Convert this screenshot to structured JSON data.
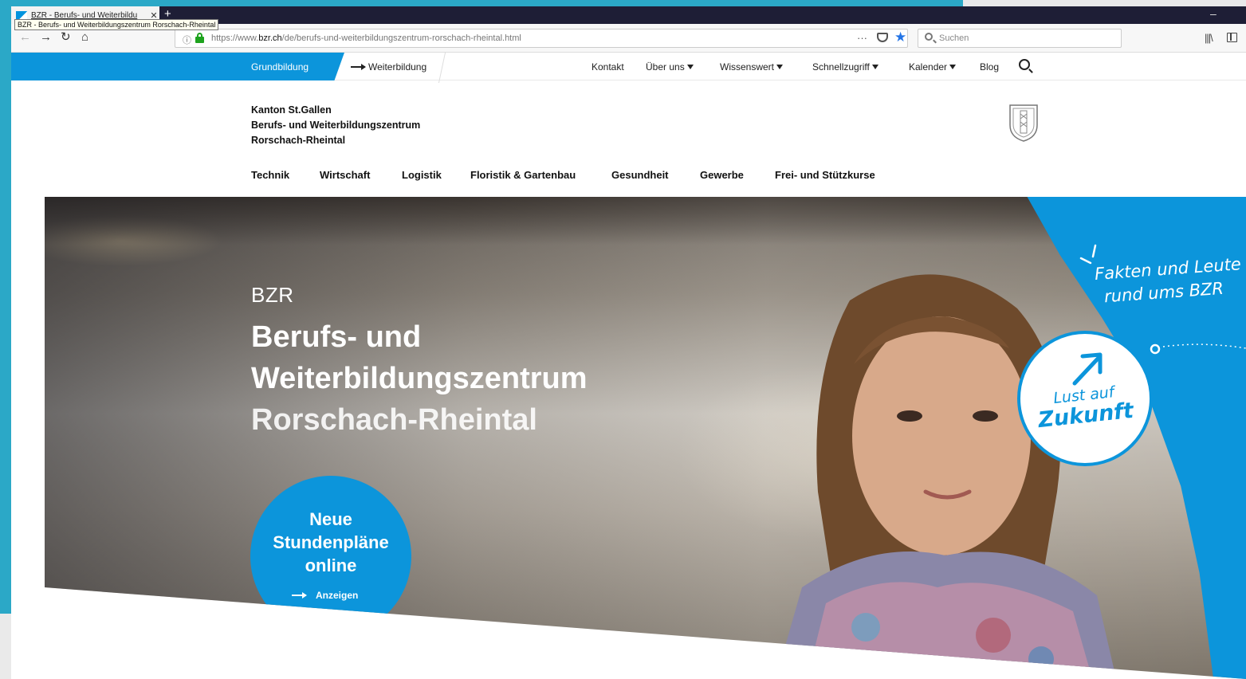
{
  "browser": {
    "tab_title": "BZR - Berufs- und Weiterbildu",
    "tab_close": "✕",
    "new_tab": "+",
    "tooltip": "BZR - Berufs- und Weiterbildungszentrum Rorschach-Rheintal",
    "url_prefix": "https://www.",
    "url_domain": "bzr.ch",
    "url_path": "/de/berufs-und-weiterbildungszentrum-rorschach-rheintal.html",
    "url_menu": "···",
    "search_placeholder": "Suchen",
    "minimize": "–",
    "icons": [
      "back-icon",
      "forward-icon",
      "reload-icon",
      "home-icon",
      "info-icon",
      "lock-icon",
      "pocket-icon",
      "star-icon",
      "library-icon",
      "sidebar-icon"
    ]
  },
  "site": {
    "topnav": {
      "tab_active": "Grundbildung",
      "tab_other": "Weiterbildung",
      "meta": [
        {
          "label": "Kontakt",
          "dropdown": false
        },
        {
          "label": "Über uns",
          "dropdown": true
        },
        {
          "label": "Wissenswert",
          "dropdown": true
        },
        {
          "label": "Schnellzugriff",
          "dropdown": true
        },
        {
          "label": "Kalender",
          "dropdown": true
        },
        {
          "label": "Blog",
          "dropdown": false
        }
      ]
    },
    "brand": {
      "line1": "Kanton St.Gallen",
      "line2": "Berufs- und Weiterbildungszentrum",
      "line3": "Rorschach-Rheintal"
    },
    "mainnav": [
      "Technik",
      "Wirtschaft",
      "Logistik",
      "Floristik & Gartenbau",
      "Gesundheit",
      "Gewerbe",
      "Frei- und Stützkurse"
    ],
    "hero": {
      "kicker": "BZR",
      "title_line1": "Berufs- und",
      "title_line2": "Weiterbildungszentrum",
      "title_line3": "Rorschach-Rheintal",
      "cta_line1": "Neue",
      "cta_line2": "Stundenpläne",
      "cta_line3": "online",
      "cta_action": "Anzeigen",
      "side_line1": "Fakten und Leute",
      "side_line2": "rund ums BZR",
      "badge_line1": "Lust auf",
      "badge_line2": "Zukunft"
    },
    "colors": {
      "brand_blue": "#0c95db",
      "tabbar": "#1e1e36",
      "desktop": "#2ba8c7"
    }
  }
}
